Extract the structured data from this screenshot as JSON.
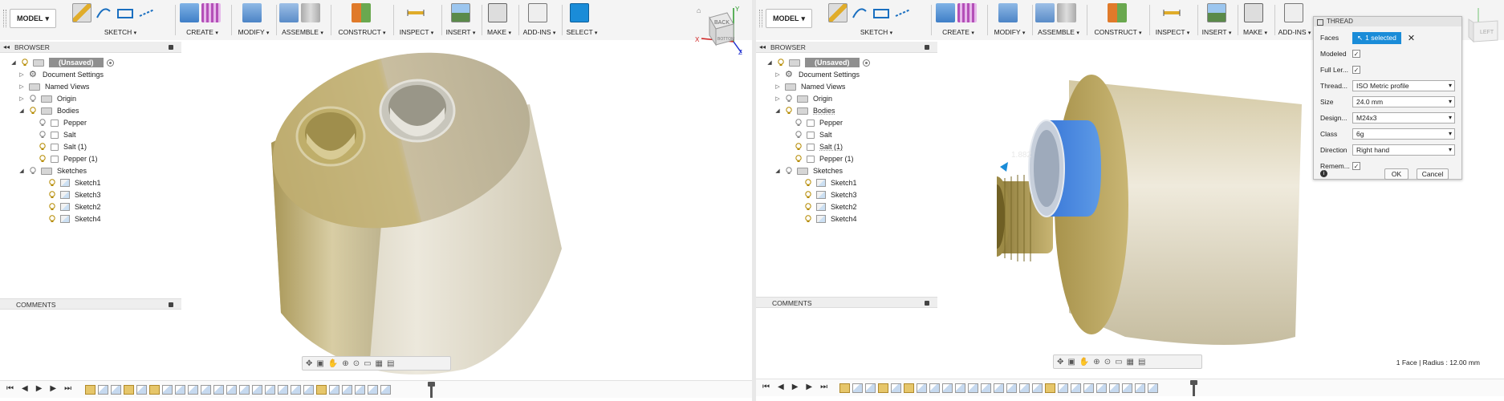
{
  "left": {
    "toolbar": {
      "model_label": "MODEL",
      "groups": [
        {
          "label": "SKETCH"
        },
        {
          "label": "CREATE"
        },
        {
          "label": "MODIFY"
        },
        {
          "label": "ASSEMBLE"
        },
        {
          "label": "CONSTRUCT"
        },
        {
          "label": "INSPECT"
        },
        {
          "label": "INSERT"
        },
        {
          "label": "MAKE"
        },
        {
          "label": "ADD-INS"
        },
        {
          "label": "SELECT"
        }
      ]
    },
    "browser": {
      "title": "BROWSER",
      "root": "(Unsaved)",
      "items": [
        {
          "label": "Document Settings"
        },
        {
          "label": "Named Views"
        },
        {
          "label": "Origin"
        },
        {
          "label": "Bodies"
        },
        {
          "label": "Pepper"
        },
        {
          "label": "Salt"
        },
        {
          "label": "Salt (1)"
        },
        {
          "label": "Pepper (1)"
        },
        {
          "label": "Sketches"
        },
        {
          "label": "Sketch1"
        },
        {
          "label": "Sketch3"
        },
        {
          "label": "Sketch2"
        },
        {
          "label": "Sketch4"
        }
      ]
    },
    "comments": "COMMENTS",
    "viewcube": {
      "face": "BACK",
      "face2": "BOTTOM",
      "axis_x": "X",
      "axis_y": "Y",
      "axis_z": "Z"
    }
  },
  "right": {
    "toolbar": {
      "model_label": "MODEL",
      "groups": [
        {
          "label": "SKETCH"
        },
        {
          "label": "CREATE"
        },
        {
          "label": "MODIFY"
        },
        {
          "label": "ASSEMBLE"
        },
        {
          "label": "CONSTRUCT"
        },
        {
          "label": "INSPECT"
        },
        {
          "label": "INSERT"
        },
        {
          "label": "MAKE"
        },
        {
          "label": "ADD-INS"
        }
      ]
    },
    "browser": {
      "title": "BROWSER",
      "root": "(Unsaved)",
      "items": [
        {
          "label": "Document Settings"
        },
        {
          "label": "Named Views"
        },
        {
          "label": "Origin"
        },
        {
          "label": "Bodies"
        },
        {
          "label": "Pepper"
        },
        {
          "label": "Salt"
        },
        {
          "label": "Salt (1)"
        },
        {
          "label": "Pepper (1)"
        },
        {
          "label": "Sketches"
        },
        {
          "label": "Sketch1"
        },
        {
          "label": "Sketch3"
        },
        {
          "label": "Sketch2"
        },
        {
          "label": "Sketch4"
        }
      ]
    },
    "comments": "COMMENTS",
    "dimension_label": "1.882",
    "viewcube": {
      "face": "LEFT"
    },
    "thread_dialog": {
      "title": "THREAD",
      "faces_label": "Faces",
      "faces_value": "1 selected",
      "modeled_label": "Modeled",
      "full_length_label": "Full Ler...",
      "thread_type_label": "Thread...",
      "thread_type_value": "ISO Metric profile",
      "size_label": "Size",
      "size_value": "24.0 mm",
      "designation_label": "Design...",
      "designation_value": "M24x3",
      "class_label": "Class",
      "class_value": "6g",
      "direction_label": "Direction",
      "direction_value": "Right hand",
      "remember_label": "Remem...",
      "ok_label": "OK",
      "cancel_label": "Cancel"
    },
    "status_text": "1 Face | Radius : 12.00 mm"
  }
}
